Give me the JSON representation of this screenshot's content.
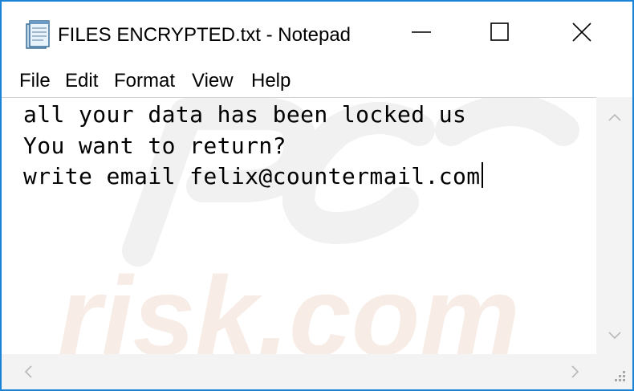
{
  "window": {
    "title": "FILES ENCRYPTED.txt - Notepad",
    "border_color": "#1883d7"
  },
  "icons": {
    "app": "notepad-icon",
    "minimize": "minimize-icon",
    "maximize": "maximize-icon",
    "close": "close-icon",
    "scroll_up": "chevron-up-icon",
    "scroll_down": "chevron-down-icon",
    "scroll_left": "chevron-left-icon",
    "scroll_right": "chevron-right-icon",
    "resize_grip": "resize-grip-icon"
  },
  "menu": [
    {
      "label": "File"
    },
    {
      "label": "Edit"
    },
    {
      "label": "Format"
    },
    {
      "label": "View"
    },
    {
      "label": "Help"
    }
  ],
  "document": {
    "lines": [
      "all your data has been locked us",
      "You want to return?",
      "write email felix@countermail.com"
    ]
  },
  "watermark": {
    "logo_text": "PC",
    "site_text": "risk.com"
  }
}
